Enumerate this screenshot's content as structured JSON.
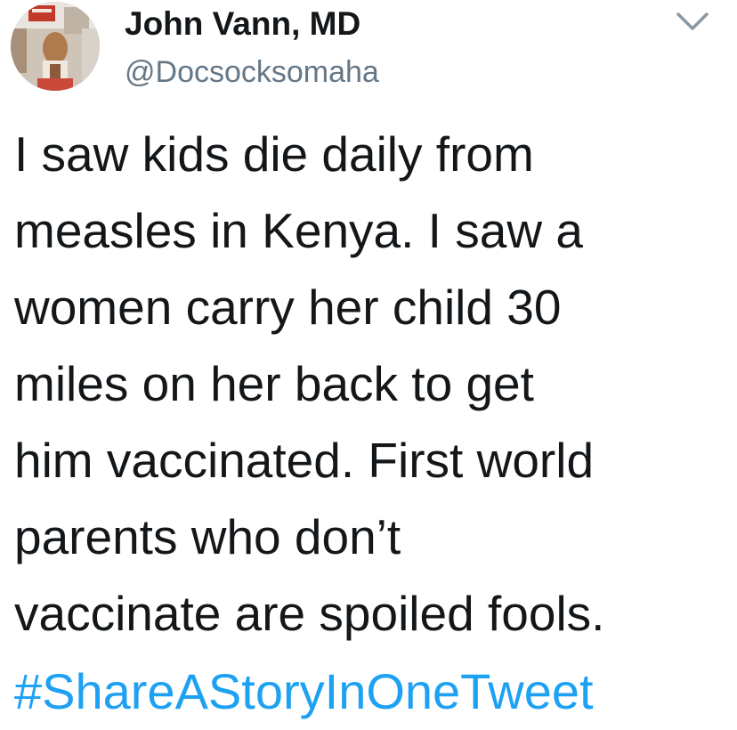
{
  "user": {
    "display_name": "John Vann, MD",
    "handle": "@Docsocksomaha"
  },
  "tweet": {
    "lines": [
      "I saw kids die daily from",
      "measles in Kenya. I saw a",
      "women carry her child 30",
      "miles on her back to get",
      "him vaccinated. First world",
      "parents who don’t",
      "vaccinate are spoiled fools."
    ],
    "hashtag": "#ShareAStoryInOneTweet"
  },
  "icons": {
    "menu": "chevron-down-icon",
    "avatar": "avatar-photo"
  },
  "colors": {
    "text": "#14171a",
    "secondary": "#657786",
    "link": "#1da1f2"
  }
}
